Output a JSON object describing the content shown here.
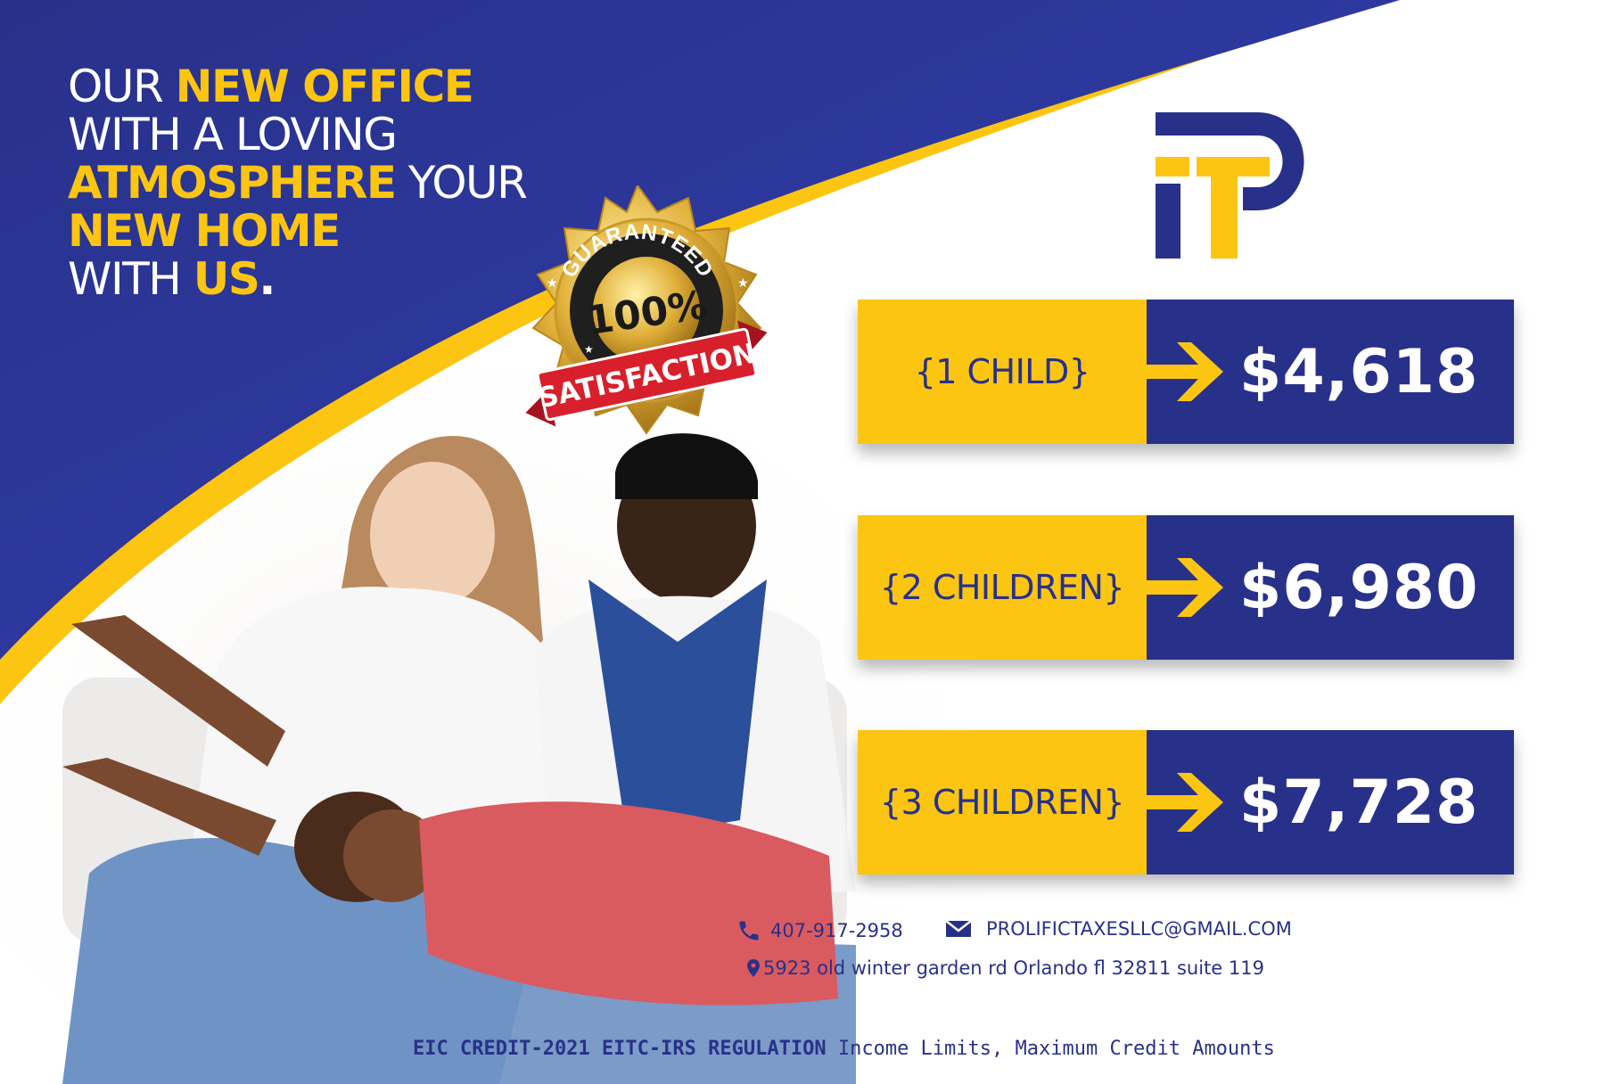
{
  "colors": {
    "navy": "#283189",
    "royal_blue": "#2c3aa6",
    "yellow": "#fcc512",
    "white": "#ffffff",
    "badge_red": "#d8202d",
    "badge_gold": "#d8a92a"
  },
  "headline": {
    "line1_plain": "OUR ",
    "line1_highlight": "NEW OFFICE",
    "line2_plain": "WITH A LOVING",
    "line3_highlight": "ATMOSPHERE",
    "line3_plain": " YOUR",
    "line4_highlight": "NEW HOME",
    "line5_plain": "WITH ",
    "line5_highlight": "US",
    "line5_period": "."
  },
  "badge": {
    "top_text": "GUARANTEED",
    "percent": "100%",
    "ribbon_text": "SATISFACTION"
  },
  "logo": {
    "icon": "tp-monogram-logo"
  },
  "credits": [
    {
      "label": "{1 CHILD}",
      "amount": "$4,618"
    },
    {
      "label": "{2 CHILDREN}",
      "amount": "$6,980"
    },
    {
      "label": "{3 CHILDREN}",
      "amount": "$7,728"
    }
  ],
  "contact": {
    "phone": "407-917-2958",
    "email": "PROLIFICTAXESLLC@GMAIL.COM",
    "address": "5923 old winter garden rd Orlando fl 32811 suite 119",
    "phone_icon": "phone-icon",
    "email_icon": "envelope-icon",
    "address_icon": "map-pin-icon"
  },
  "footnote": {
    "bold_part": "EIC CREDIT-2021 EITC-IRS REGULATION",
    "regular_part": " Income Limits, Maximum Credit Amounts"
  }
}
